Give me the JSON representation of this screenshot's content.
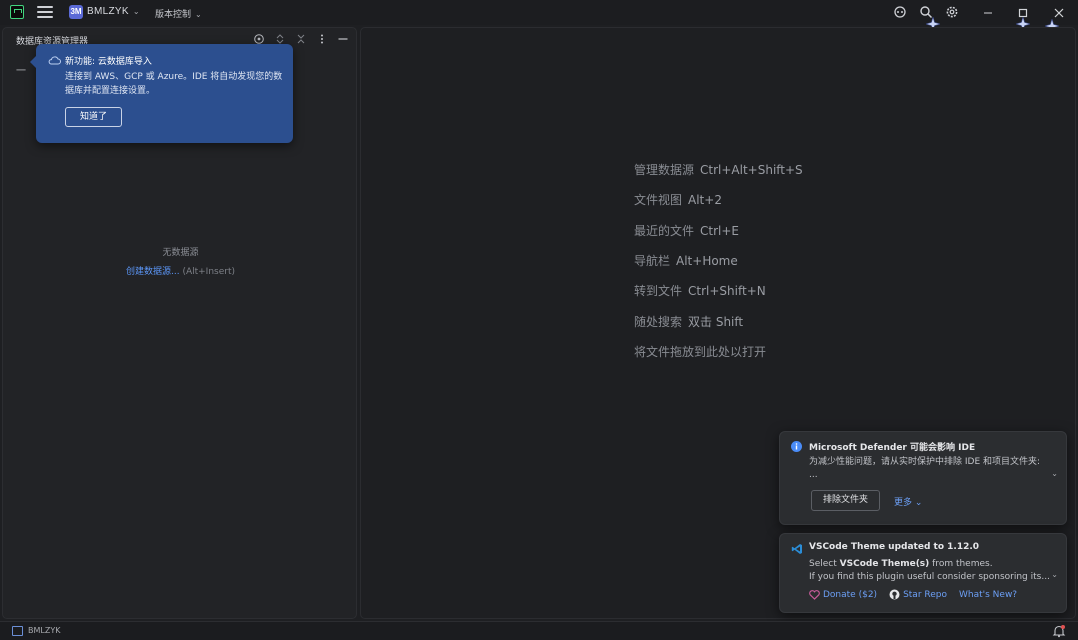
{
  "titlebar": {
    "project_badge": "3M",
    "project_name": "BMLZYK",
    "vcs_label": "版本控制",
    "chevron": "⌄",
    "icons": [
      "app-logo-icon",
      "hamburger-menu-icon",
      "copilot-icon",
      "search-icon",
      "settings-icon",
      "minimize-icon",
      "maximize-icon",
      "close-icon"
    ]
  },
  "db_panel": {
    "title": "数据库资源管理器",
    "tree_stub": "一",
    "empty_text": "无数据源",
    "create_link": "创建数据源...",
    "create_shortcut": "(Alt+Insert)"
  },
  "callout": {
    "title": "新功能: 云数据库导入",
    "body": "连接到 AWS、GCP 或 Azure。IDE 将自动发现您的数据库并配置连接设置。",
    "button": "知道了"
  },
  "editor_hints": [
    {
      "label": "管理数据源",
      "key": "Ctrl+Alt+Shift+S"
    },
    {
      "label": "文件视图",
      "key": "Alt+2"
    },
    {
      "label": "最近的文件",
      "key": "Ctrl+E"
    },
    {
      "label": "导航栏",
      "key": "Alt+Home"
    },
    {
      "label": "转到文件",
      "key": "Ctrl+Shift+N"
    },
    {
      "label": "随处搜索",
      "key": "双击 Shift"
    },
    {
      "label": "将文件拖放到此处以打开",
      "key": ""
    }
  ],
  "notifications": {
    "defender": {
      "title": "Microsoft Defender 可能会影响 IDE",
      "body_line1": "为减少性能问题，请从实时保护中排除 IDE 和项目文件夹:",
      "body_line2": "...",
      "button": "排除文件夹",
      "more": "更多 ⌄",
      "caret": "⌄"
    },
    "vscode": {
      "title": "VSCode Theme updated to 1.12.0",
      "body_line1_pre": "Select ",
      "body_line1_bold": "VSCode Theme(s)",
      "body_line1_post": " from themes.",
      "body_line2": "If you find this plugin useful consider sponsoring its...",
      "caret": "⌄",
      "donate": "Donate ($2)",
      "star": "Star Repo",
      "whats_new": "What's New?"
    }
  },
  "statusbar": {
    "project": "BMLZYK"
  },
  "colors": {
    "accent_blue": "#5b95f5",
    "callout_bg": "#2c4f8f",
    "info_blue": "#4a8cf7",
    "donate_pink": "#c75b9a"
  }
}
